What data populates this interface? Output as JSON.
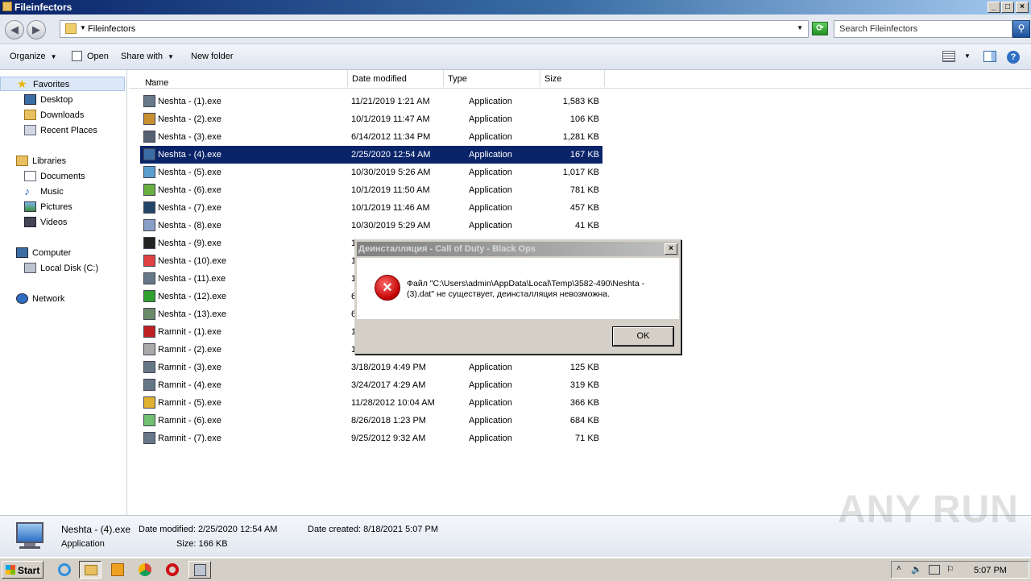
{
  "window": {
    "title": "Fileinfectors"
  },
  "address": {
    "path": "Fileinfectors",
    "search_placeholder": "Search Fileinfectors"
  },
  "toolbar": {
    "organize": "Organize",
    "open": "Open",
    "share_with": "Share with",
    "new_folder": "New folder"
  },
  "sidebar": {
    "favorites": "Favorites",
    "fav_items": [
      "Desktop",
      "Downloads",
      "Recent Places"
    ],
    "libraries": "Libraries",
    "lib_items": [
      "Documents",
      "Music",
      "Pictures",
      "Videos"
    ],
    "computer": "Computer",
    "drive": "Local Disk (C:)",
    "network": "Network"
  },
  "columns": {
    "name": "Name",
    "date": "Date modified",
    "type": "Type",
    "size": "Size"
  },
  "files": [
    {
      "name": "Neshta - (1).exe",
      "date": "11/21/2019 1:21 AM",
      "type": "Application",
      "size": "1,583 KB"
    },
    {
      "name": "Neshta - (2).exe",
      "date": "10/1/2019 11:47 AM",
      "type": "Application",
      "size": "106 KB"
    },
    {
      "name": "Neshta - (3).exe",
      "date": "6/14/2012 11:34 PM",
      "type": "Application",
      "size": "1,281 KB"
    },
    {
      "name": "Neshta - (4).exe",
      "date": "2/25/2020 12:54 AM",
      "type": "Application",
      "size": "167 KB",
      "selected": true
    },
    {
      "name": "Neshta - (5).exe",
      "date": "10/30/2019 5:26 AM",
      "type": "Application",
      "size": "1,017 KB"
    },
    {
      "name": "Neshta - (6).exe",
      "date": "10/1/2019 11:50 AM",
      "type": "Application",
      "size": "781 KB"
    },
    {
      "name": "Neshta - (7).exe",
      "date": "10/1/2019 11:46 AM",
      "type": "Application",
      "size": "457 KB"
    },
    {
      "name": "Neshta - (8).exe",
      "date": "10/30/2019 5:29 AM",
      "type": "Application",
      "size": "41 KB"
    },
    {
      "name": "Neshta - (9).exe",
      "date": "1",
      "type": "",
      "size": ""
    },
    {
      "name": "Neshta - (10).exe",
      "date": "1",
      "type": "",
      "size": ""
    },
    {
      "name": "Neshta - (11).exe",
      "date": "1",
      "type": "",
      "size": ""
    },
    {
      "name": "Neshta - (12).exe",
      "date": "6",
      "type": "",
      "size": ""
    },
    {
      "name": "Neshta - (13).exe",
      "date": "6",
      "type": "",
      "size": ""
    },
    {
      "name": "Ramnit - (1).exe",
      "date": "1",
      "type": "",
      "size": ""
    },
    {
      "name": "Ramnit - (2).exe",
      "date": "1",
      "type": "",
      "size": ""
    },
    {
      "name": "Ramnit - (3).exe",
      "date": "3/18/2019 4:49 PM",
      "type": "Application",
      "size": "125 KB"
    },
    {
      "name": "Ramnit - (4).exe",
      "date": "3/24/2017 4:29 AM",
      "type": "Application",
      "size": "319 KB"
    },
    {
      "name": "Ramnit - (5).exe",
      "date": "11/28/2012 10:04 AM",
      "type": "Application",
      "size": "366 KB"
    },
    {
      "name": "Ramnit - (6).exe",
      "date": "8/26/2018 1:23 PM",
      "type": "Application",
      "size": "684 KB"
    },
    {
      "name": "Ramnit - (7).exe",
      "date": "9/25/2012 9:32 AM",
      "type": "Application",
      "size": "71 KB"
    }
  ],
  "details": {
    "name": "Neshta - (4).exe",
    "type": "Application",
    "modified": "Date modified: 2/25/2020 12:54 AM",
    "size": "Size: 166 KB",
    "created": "Date created: 8/18/2021 5:07 PM"
  },
  "dialog": {
    "title": "Деинсталляция - Call of Duty - Black Ops",
    "message": "Файл \"C:\\Users\\admin\\AppData\\Local\\Temp\\3582-490\\Neshta - (3).dat\" не существует, деинсталляция невозможна.",
    "ok": "OK"
  },
  "taskbar": {
    "start": "Start",
    "clock": "5:07 PM"
  },
  "watermark": "ANY RUN"
}
